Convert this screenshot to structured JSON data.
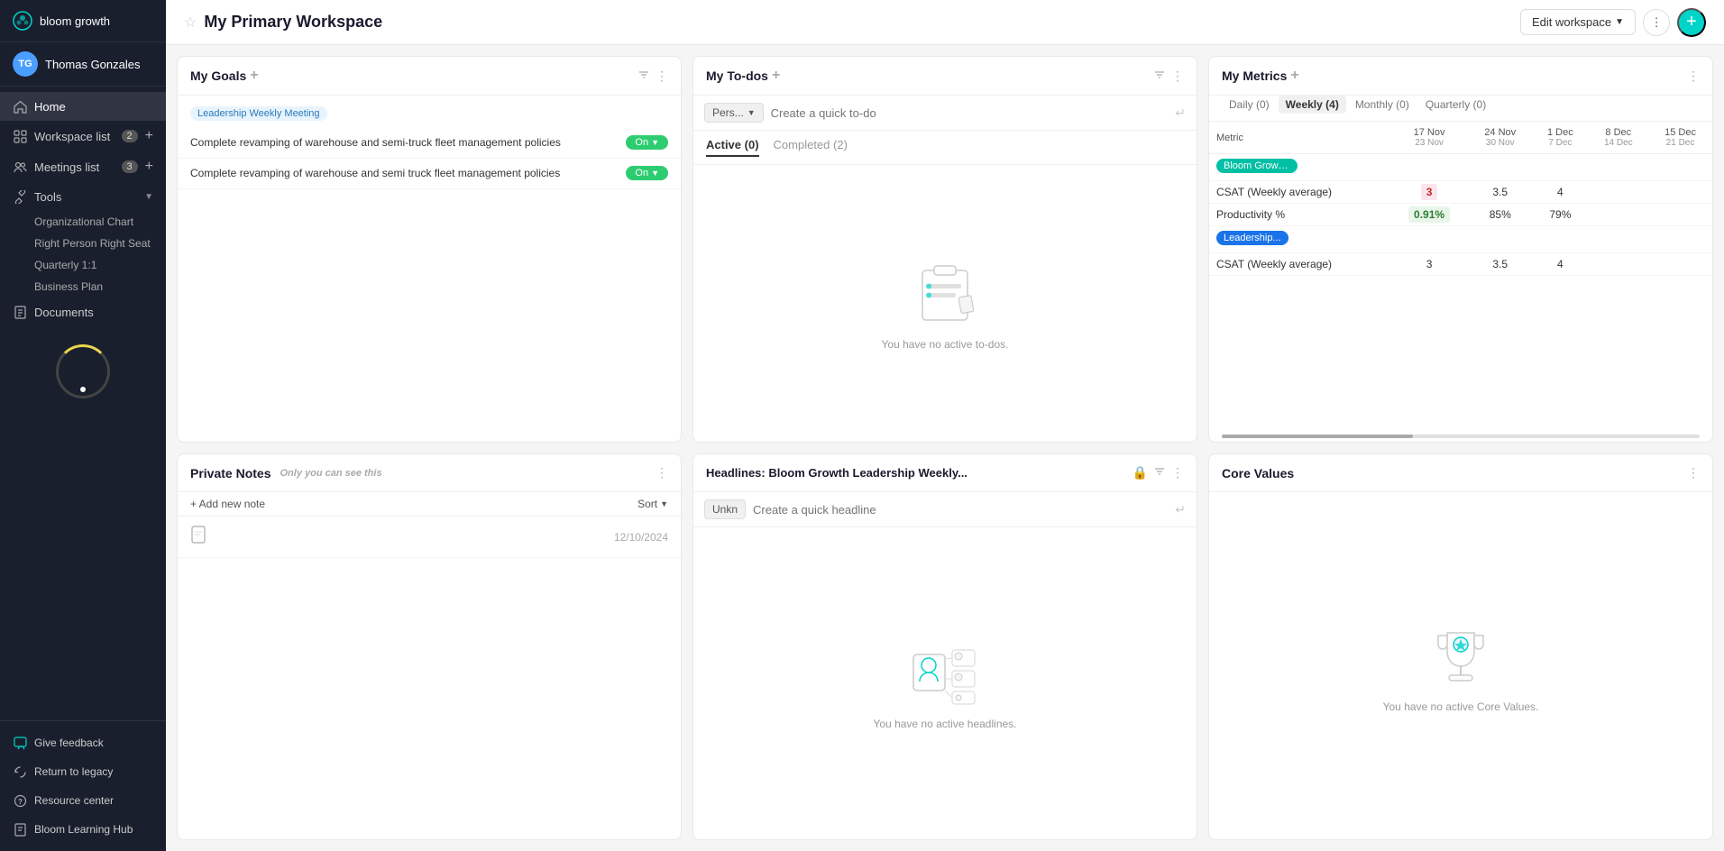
{
  "app": {
    "name": "bloom growth",
    "logo_text": "bloom growth"
  },
  "sidebar": {
    "user": {
      "name": "Thomas Gonzales",
      "initials": "TG"
    },
    "nav_items": [
      {
        "id": "home",
        "label": "Home",
        "icon": "home",
        "active": true
      },
      {
        "id": "workspace-list",
        "label": "Workspace list",
        "badge": "2",
        "icon": "grid",
        "active": false
      },
      {
        "id": "meetings-list",
        "label": "Meetings list",
        "badge": "3",
        "icon": "people",
        "active": false
      }
    ],
    "tools_section": {
      "label": "Tools",
      "items": [
        {
          "label": "Organizational Chart"
        },
        {
          "label": "Right Person Right Seat"
        },
        {
          "label": "Quarterly 1:1"
        },
        {
          "label": "Business Plan"
        }
      ]
    },
    "documents": {
      "label": "Documents",
      "icon": "doc"
    },
    "bottom_items": [
      {
        "id": "feedback",
        "label": "Give feedback",
        "icon": "chat"
      },
      {
        "id": "legacy",
        "label": "Return to legacy",
        "icon": "rotate"
      },
      {
        "id": "resource",
        "label": "Resource center",
        "icon": "question"
      },
      {
        "id": "learning",
        "label": "Bloom Learning Hub",
        "icon": "book"
      }
    ]
  },
  "topbar": {
    "title": "My Primary Workspace",
    "edit_workspace_label": "Edit workspace",
    "add_button_symbol": "+"
  },
  "goals_card": {
    "title": "My Goals",
    "tag": "Leadership Weekly Meeting",
    "goals": [
      {
        "text": "Complete revamping of warehouse and semi-truck fleet management policies",
        "status": "On"
      },
      {
        "text": "Complete revamping of warehouse and semi truck fleet management policies",
        "status": "On"
      }
    ]
  },
  "todos_card": {
    "title": "My To-dos",
    "input_placeholder": "Create a quick to-do",
    "person_label": "Pers...",
    "tabs": [
      {
        "label": "Active (0)",
        "active": true
      },
      {
        "label": "Completed (2)",
        "active": false
      }
    ],
    "empty_text": "You have no active to-dos."
  },
  "metrics_card": {
    "title": "My Metrics",
    "tabs": [
      {
        "label": "Daily (0)",
        "active": false
      },
      {
        "label": "Weekly (4)",
        "active": true
      },
      {
        "label": "Monthly (0)",
        "active": false
      },
      {
        "label": "Quarterly (0)",
        "active": false
      }
    ],
    "table": {
      "columns": [
        {
          "header": "Metric",
          "sub": ""
        },
        {
          "header": "17 Nov",
          "sub": "23 Nov"
        },
        {
          "header": "24 Nov",
          "sub": "30 Nov"
        },
        {
          "header": "1 Dec",
          "sub": "7 Dec"
        },
        {
          "header": "8 Dec",
          "sub": "14 Dec"
        },
        {
          "header": "15 Dec",
          "sub": "21 Dec"
        }
      ],
      "rows": [
        {
          "metric_chip": "Bloom Growth...",
          "chip_color": "teal",
          "metric_name": "",
          "is_header_row": true
        },
        {
          "label": "CSAT (Weekly average)",
          "values": [
            "3",
            "3.5",
            "4",
            "",
            ""
          ],
          "highlight_idx": 0
        },
        {
          "label": "Productivity %",
          "values": [
            "0.91%",
            "85%",
            "79%",
            "",
            ""
          ],
          "highlight_idx": 0
        },
        {
          "metric_chip": "Leadership...",
          "chip_color": "blue",
          "metric_name": "",
          "is_header_row": true
        },
        {
          "label": "CSAT (Weekly average)",
          "values": [
            "3",
            "3.5",
            "4",
            "",
            ""
          ],
          "highlight_idx": 0
        }
      ]
    }
  },
  "private_notes_card": {
    "title": "Private Notes",
    "only_you_label": "Only you can see this",
    "add_label": "+ Add new note",
    "sort_label": "Sort",
    "notes": [
      {
        "date": "12/10/2024"
      }
    ]
  },
  "headlines_card": {
    "title": "Headlines: Bloom Growth Leadership Weekly...",
    "input_placeholder": "Create a quick headline",
    "person_label": "Unkn",
    "empty_text": "You have no active headlines."
  },
  "core_values_card": {
    "title": "Core Values",
    "empty_text": "You have no active Core Values."
  }
}
